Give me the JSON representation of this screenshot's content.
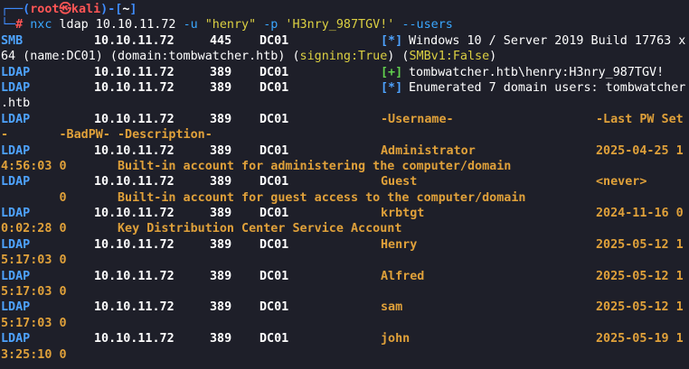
{
  "prompt": {
    "corner_top": "┌──(",
    "user": "root",
    "at": "㉿",
    "host": "kali",
    "sep": ")-[",
    "cwd": "~",
    "close": "]",
    "corner_bottom": "└─",
    "hash": "#",
    "cmd_nxc": "nxc",
    "cmd_ldap": " ldap 10.10.11.72 ",
    "flag_u": "-u",
    "user_arg": " \"henry\" ",
    "flag_p": "-p",
    "pass_arg": " 'H3nry_987TGV!' ",
    "flag_users": "--users"
  },
  "lines": [
    {
      "proto": "SMB",
      "ip": "10.10.11.72",
      "port": "445",
      "host": "DC01",
      "marker": "[*]",
      "marker_type": "info",
      "msg": "Windows 10 / Server 2019 Build 17763 x"
    },
    {
      "cont": true,
      "segments": [
        {
          "t": "64 (name:DC01) (domain:tombwatcher.htb) (",
          "c": "white"
        },
        {
          "t": "signing:True",
          "c": "yellow"
        },
        {
          "t": ") (",
          "c": "white"
        },
        {
          "t": "SMBv1:False",
          "c": "yellow"
        },
        {
          "t": ")",
          "c": "white"
        }
      ]
    },
    {
      "proto": "LDAP",
      "ip": "10.10.11.72",
      "port": "389",
      "host": "DC01",
      "marker": "[+]",
      "marker_type": "success",
      "msg": "tombwatcher.htb\\henry:H3nry_987TGV!"
    },
    {
      "proto": "LDAP",
      "ip": "10.10.11.72",
      "port": "389",
      "host": "DC01",
      "marker": "[*]",
      "marker_type": "info",
      "msg": "Enumerated 7 domain users: tombwatcher"
    },
    {
      "cont": true,
      "segments": [
        {
          "t": ".htb",
          "c": "white"
        }
      ]
    },
    {
      "proto": "LDAP",
      "ip": "10.10.11.72",
      "port": "389",
      "host": "DC01",
      "gold_name": "-Username-",
      "gold_date": "-Last PW Set"
    },
    {
      "cont": true,
      "segments": [
        {
          "t": "-       -BadPW- -Description-",
          "c": "gold"
        }
      ]
    },
    {
      "proto": "LDAP",
      "ip": "10.10.11.72",
      "port": "389",
      "host": "DC01",
      "gold_name": "Administrator",
      "gold_date": "2025-04-25 1"
    },
    {
      "cont": true,
      "segments": [
        {
          "t": "4:56:03 0       Built-in account for administering the computer/domain",
          "c": "gold"
        }
      ]
    },
    {
      "proto": "LDAP",
      "ip": "10.10.11.72",
      "port": "389",
      "host": "DC01",
      "gold_name": "Guest",
      "gold_date": "<never>"
    },
    {
      "cont": true,
      "segments": [
        {
          "t": "        0       Built-in account for guest access to the computer/domain",
          "c": "gold"
        }
      ]
    },
    {
      "proto": "LDAP",
      "ip": "10.10.11.72",
      "port": "389",
      "host": "DC01",
      "gold_name": "krbtgt",
      "gold_date": "2024-11-16 0"
    },
    {
      "cont": true,
      "segments": [
        {
          "t": "0:02:28 0       Key Distribution Center Service Account",
          "c": "gold"
        }
      ]
    },
    {
      "proto": "LDAP",
      "ip": "10.10.11.72",
      "port": "389",
      "host": "DC01",
      "gold_name": "Henry",
      "gold_date": "2025-05-12 1"
    },
    {
      "cont": true,
      "segments": [
        {
          "t": "5:17:03 0",
          "c": "gold"
        }
      ]
    },
    {
      "proto": "LDAP",
      "ip": "10.10.11.72",
      "port": "389",
      "host": "DC01",
      "gold_name": "Alfred",
      "gold_date": "2025-05-12 1"
    },
    {
      "cont": true,
      "segments": [
        {
          "t": "5:17:03 0",
          "c": "gold"
        }
      ]
    },
    {
      "proto": "LDAP",
      "ip": "10.10.11.72",
      "port": "389",
      "host": "DC01",
      "gold_name": "sam",
      "gold_date": "2025-05-12 1"
    },
    {
      "cont": true,
      "segments": [
        {
          "t": "5:17:03 0",
          "c": "gold"
        }
      ]
    },
    {
      "proto": "LDAP",
      "ip": "10.10.11.72",
      "port": "389",
      "host": "DC01",
      "gold_name": "john",
      "gold_date": "2025-05-19 1"
    },
    {
      "cont": true,
      "segments": [
        {
          "t": "3:25:10 0",
          "c": "gold"
        }
      ]
    }
  ],
  "colors": {
    "background": "#1e1f29",
    "prompt_blue": "#3f8cff",
    "prompt_red": "#ff5555",
    "gold": "#e0a13a",
    "info_blue": "#4ea3ff",
    "success_green": "#62d04e",
    "yellow": "#dcd042"
  }
}
